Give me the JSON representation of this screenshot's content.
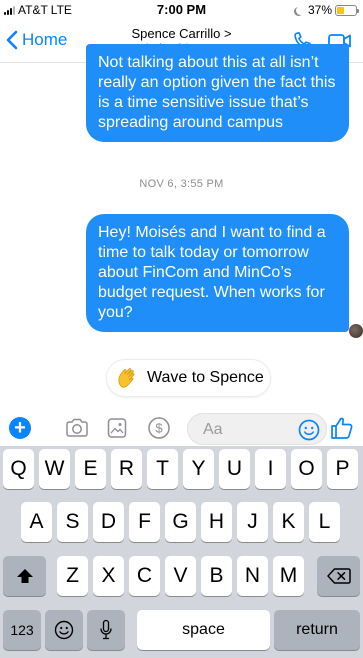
{
  "status_bar": {
    "carrier": "AT&T",
    "network": "LTE",
    "time": "7:00 PM",
    "battery": "37%",
    "battery_level": 0.37
  },
  "header": {
    "back_label": "Home",
    "contact_name": "Spence Carrillo >",
    "contact_status": "Active 24m ago"
  },
  "messages": [
    {
      "text": "Not talking about this at all isn’t really an option given the fact this is a time sensitive issue that’s spreading around campus"
    },
    {
      "text": "Hey! Moisés and I want to find a time to talk today or tomorrow about FinCom and MinCo’s budget request. When works for you?"
    }
  ],
  "timestamp": "NOV 6, 3:55 PM",
  "wave_button": {
    "label": "Wave to Spence"
  },
  "composer": {
    "placeholder": "Aa"
  },
  "keyboard": {
    "row1": [
      "Q",
      "W",
      "E",
      "R",
      "T",
      "Y",
      "U",
      "I",
      "O",
      "P"
    ],
    "row2": [
      "A",
      "S",
      "D",
      "F",
      "G",
      "H",
      "J",
      "K",
      "L"
    ],
    "row3": [
      "Z",
      "X",
      "C",
      "V",
      "B",
      "N",
      "M"
    ],
    "numbers_label": "123",
    "space_label": "space",
    "return_label": "return"
  },
  "colors": {
    "accent": "#0a84ff",
    "bubble": "#1f8ef8",
    "keyboard_bg": "#d2d5db"
  },
  "icons": [
    "chevron-left-icon",
    "phone-icon",
    "video-icon",
    "plus-icon",
    "camera-icon",
    "image-icon",
    "dollar-icon",
    "smiley-icon",
    "thumbs-up-icon",
    "shift-icon",
    "backspace-icon",
    "emoji-key-icon",
    "microphone-icon"
  ]
}
